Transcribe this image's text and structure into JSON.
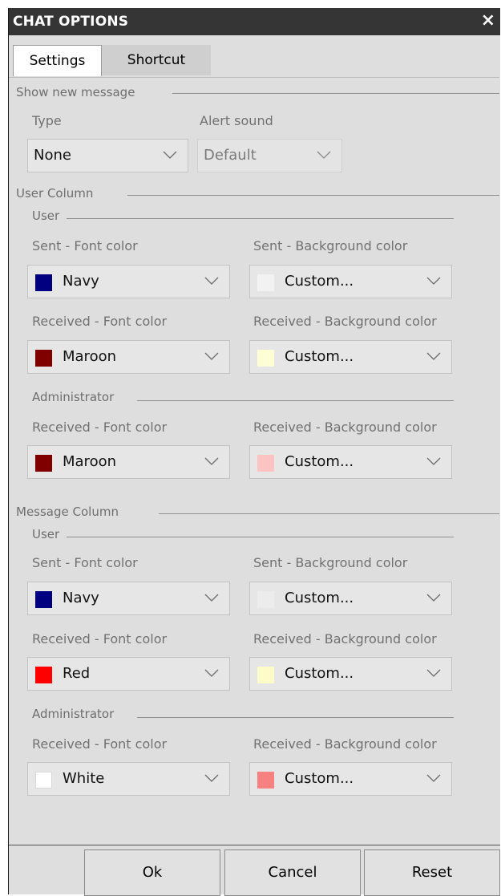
{
  "window": {
    "title": "CHAT OPTIONS",
    "close_icon": "×"
  },
  "tabs": [
    {
      "label": "Settings",
      "active": true
    },
    {
      "label": "Shortcut",
      "active": false
    }
  ],
  "show_new_message": {
    "title": "Show new message",
    "type": {
      "label": "Type",
      "value": "None"
    },
    "alert_sound": {
      "label": "Alert sound",
      "value": "Default",
      "disabled": true
    }
  },
  "user_column": {
    "title": "User Column",
    "user": {
      "title": "User",
      "sent_font": {
        "label": "Sent - Font color",
        "value": "Navy",
        "swatch": "#000080"
      },
      "sent_bg": {
        "label": "Sent - Background color",
        "value": "Custom...",
        "swatch": "#f2f2f2"
      },
      "recv_font": {
        "label": "Received - Font color",
        "value": "Maroon",
        "swatch": "#800000"
      },
      "recv_bg": {
        "label": "Received - Background color",
        "value": "Custom...",
        "swatch": "#fdfdd6"
      }
    },
    "administrator": {
      "title": "Administrator",
      "recv_font": {
        "label": "Received - Font color",
        "value": "Maroon",
        "swatch": "#800000"
      },
      "recv_bg": {
        "label": "Received - Background color",
        "value": "Custom...",
        "swatch": "#fcc3c3"
      }
    }
  },
  "message_column": {
    "title": "Message Column",
    "user": {
      "title": "User",
      "sent_font": {
        "label": "Sent - Font color",
        "value": "Navy",
        "swatch": "#000080"
      },
      "sent_bg": {
        "label": "Sent - Background color",
        "value": "Custom...",
        "swatch": "#ececec"
      },
      "recv_font": {
        "label": "Received - Font color",
        "value": "Red",
        "swatch": "#ff0000"
      },
      "recv_bg": {
        "label": "Received - Background color",
        "value": "Custom...",
        "swatch": "#fdfcc9"
      }
    },
    "administrator": {
      "title": "Administrator",
      "recv_font": {
        "label": "Received - Font color",
        "value": "White",
        "swatch": "#ffffff"
      },
      "recv_bg": {
        "label": "Received - Background color",
        "value": "Custom...",
        "swatch": "#f78080"
      }
    }
  },
  "buttons": {
    "ok": "Ok",
    "cancel": "Cancel",
    "reset": "Reset"
  }
}
